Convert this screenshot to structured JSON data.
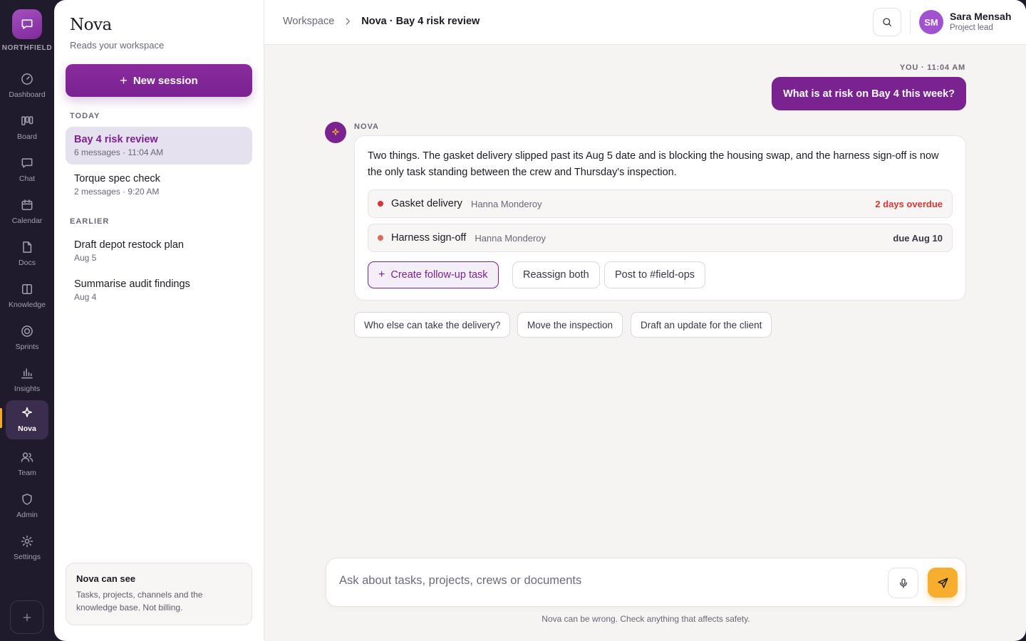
{
  "colors": {
    "brand": "#7a2290",
    "accent": "#f7ad2e",
    "overdue": "#d93434",
    "rail_bg": "#1f1b2d"
  },
  "rail": {
    "brand_name": "NORTHFIELD",
    "items": [
      {
        "label": "Dashboard",
        "icon": "gauge-icon"
      },
      {
        "label": "Board",
        "icon": "kanban-icon"
      },
      {
        "label": "Chat",
        "icon": "chat-icon"
      },
      {
        "label": "Calendar",
        "icon": "calendar-icon"
      },
      {
        "label": "Docs",
        "icon": "document-icon"
      },
      {
        "label": "Knowledge",
        "icon": "book-icon"
      },
      {
        "label": "Sprints",
        "icon": "target-icon"
      },
      {
        "label": "Insights",
        "icon": "bar-chart-icon"
      },
      {
        "label": "Nova",
        "icon": "sparkle-icon"
      },
      {
        "label": "Team",
        "icon": "users-icon"
      },
      {
        "label": "Admin",
        "icon": "shield-icon"
      },
      {
        "label": "Settings",
        "icon": "gear-icon"
      }
    ],
    "active_label": "Nova"
  },
  "sessions": {
    "title": "Nova",
    "subtitle": "Reads your workspace",
    "new_session_label": "New session",
    "today_label": "TODAY",
    "earlier_label": "EARLIER",
    "today": [
      {
        "title": "Bay 4 risk review",
        "meta": "6 messages · 11:04 AM"
      },
      {
        "title": "Torque spec check",
        "meta": "2 messages · 9:20 AM"
      }
    ],
    "earlier": [
      {
        "title": "Draft depot restock plan",
        "meta": "Aug 5"
      },
      {
        "title": "Summarise audit findings",
        "meta": "Aug 4"
      }
    ],
    "can_see": {
      "title": "Nova can see",
      "body": "Tasks, projects, channels and the knowledge base. Not billing."
    }
  },
  "header": {
    "breadcrumb_root": "Workspace",
    "breadcrumb_current": "Nova · Bay 4 risk review",
    "user": {
      "initials": "SM",
      "name": "Sara Mensah",
      "role": "Project lead"
    }
  },
  "conversation": {
    "user_meta": "YOU · 11:04 AM",
    "user_message": "What is at risk on Bay 4 this week?",
    "nova_label": "NOVA",
    "nova_message": "Two things. The gasket delivery slipped past its Aug 5 date and is blocking the housing swap, and the harness sign-off is now the only task standing between the crew and Thursday's inspection.",
    "tasks": [
      {
        "name": "Gasket delivery",
        "owner": "Hanna Monderoy",
        "status": "2 days overdue",
        "status_color": "#d93434",
        "dot_color": "#d93434"
      },
      {
        "name": "Harness sign-off",
        "owner": "Hanna Monderoy",
        "status": "due Aug 10",
        "status_color": "#3a3644",
        "dot_color": "#e06a5a"
      }
    ],
    "actions": [
      "Create follow-up task",
      "Reassign both",
      "Post to #field-ops"
    ],
    "suggestions": [
      "Who else can take the delivery?",
      "Move the inspection",
      "Draft an update for the client"
    ]
  },
  "composer": {
    "placeholder": "Ask about tasks, projects, crews or documents",
    "value": "",
    "disclaimer": "Nova can be wrong. Check anything that affects safety."
  }
}
